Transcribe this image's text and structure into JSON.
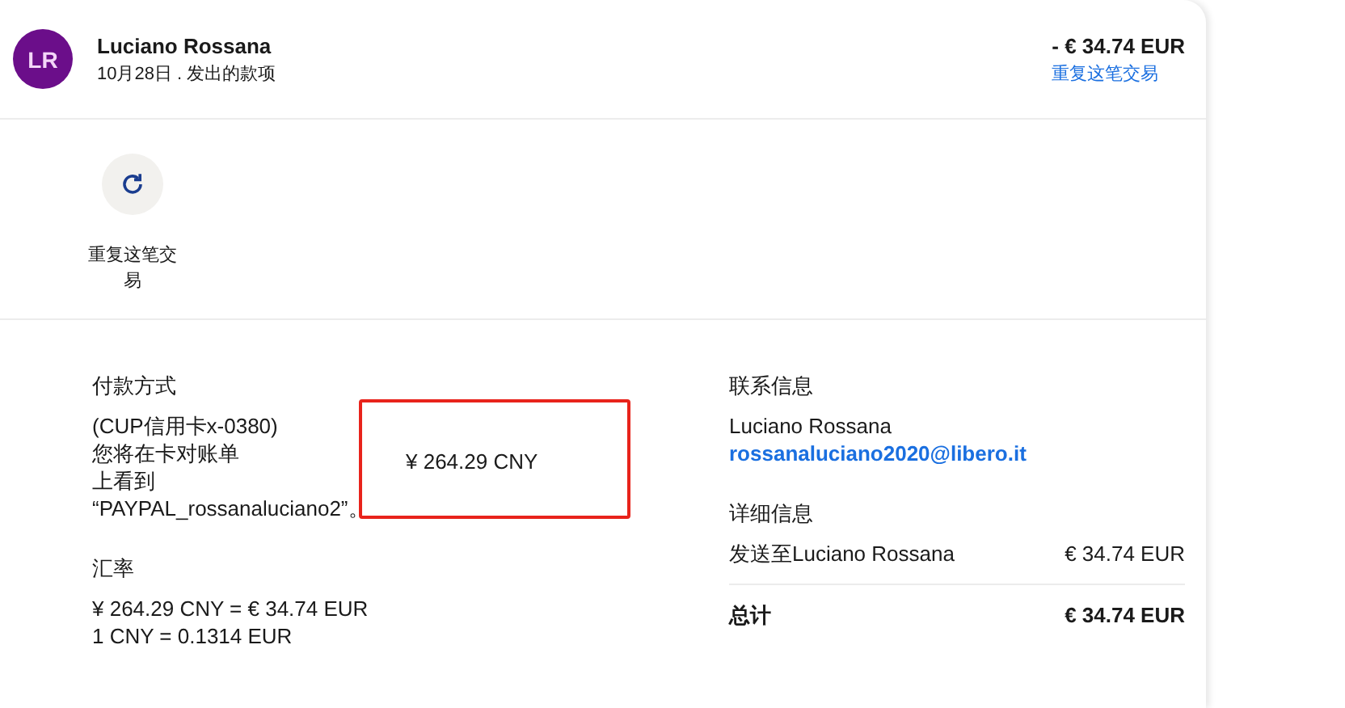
{
  "header": {
    "avatar_initials": "LR",
    "name": "Luciano Rossana",
    "subtitle": "10月28日 . 发出的款项",
    "amount": "- € 34.74 EUR",
    "repeat_link": "重复这笔交易"
  },
  "actions": [
    {
      "label": "重复这笔交易"
    }
  ],
  "payment": {
    "heading": "付款方式",
    "method": "(CUP信用卡x-0380)",
    "lines": [
      "您将在卡对账单",
      "上看到",
      "“PAYPAL_rossanaluciano2”。"
    ],
    "amount": "¥ 264.29 CNY",
    "highlighted": true
  },
  "exchange": {
    "heading": "汇率",
    "lines": [
      "¥ 264.29 CNY = € 34.74 EUR",
      "1 CNY = 0.1314 EUR"
    ]
  },
  "contact": {
    "heading": "联系信息",
    "name": "Luciano Rossana",
    "email": "rossanaluciano2020@libero.it"
  },
  "details": {
    "heading": "详细信息",
    "rows": [
      {
        "label": "发送至Luciano Rossana",
        "value": "€ 34.74 EUR"
      }
    ],
    "total_label": "总计",
    "total_value": "€ 34.74 EUR"
  }
}
